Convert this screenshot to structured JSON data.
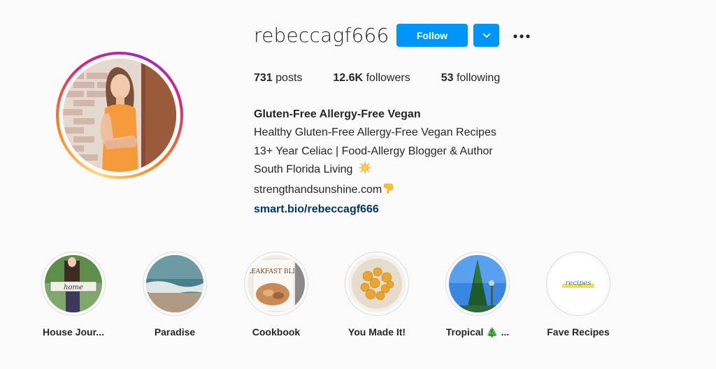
{
  "profile": {
    "username": "rebeccagf666",
    "follow_label": "Follow",
    "stats": {
      "posts_count": "731",
      "posts_label": "posts",
      "followers_count": "12.6K",
      "followers_label": "followers",
      "following_count": "53",
      "following_label": "following"
    },
    "bio": {
      "name": "Gluten-Free Allergy-Free Vegan",
      "line1": "Healthy Gluten-Free Allergy-Free Vegan Recipes",
      "line2": "13+ Year Celiac | Food-Allergy Blogger & Author",
      "line3": "South Florida Living",
      "line3_emoji": "sun-emoji",
      "line4": "strengthandsunshine.com",
      "line4_emoji": "pointing-down-emoji",
      "link": "smart.bio/rebeccagf666"
    }
  },
  "highlights": [
    {
      "label": "House Jour...",
      "image_text": "home"
    },
    {
      "label": "Paradise"
    },
    {
      "label": "Cookbook",
      "image_text": "BREAKFAST BLISS"
    },
    {
      "label": "You Made It!"
    },
    {
      "label": "Tropical 🎄 ..."
    },
    {
      "label": "Fave Recipes",
      "image_text": "recipes"
    }
  ],
  "colors": {
    "primary_button": "#0095f6",
    "link": "#00376b",
    "text": "#262626",
    "background": "#fafafa"
  }
}
